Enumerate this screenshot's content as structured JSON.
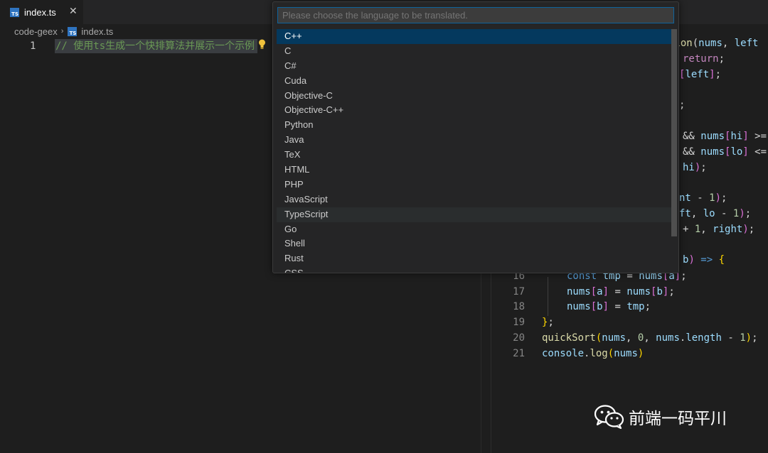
{
  "tab": {
    "icon_label": "TS",
    "title": "index.ts",
    "close_glyph": "✕"
  },
  "breadcrumb": {
    "folder": "code-geex",
    "separator": "›",
    "file": "index.ts"
  },
  "left_editor": {
    "line_number": "1",
    "comment": "// 使用ts生成一个快排算法并展示一个示例",
    "lightbulb_icon": "lightbulb-icon"
  },
  "quick_pick": {
    "placeholder": "Please choose the language to be translated.",
    "items": [
      "C++",
      "C",
      "C#",
      "Cuda",
      "Objective-C",
      "Objective-C++",
      "Python",
      "Java",
      "TeX",
      "HTML",
      "PHP",
      "JavaScript",
      "TypeScript",
      "Go",
      "Shell",
      "Rust",
      "CSS"
    ],
    "selected": "C++",
    "hovered": "TypeScript"
  },
  "right_editor": {
    "line_numbers": [
      "16",
      "17",
      "18",
      "19",
      "20",
      "21"
    ]
  },
  "watermark": {
    "text": "前端一码平川"
  }
}
